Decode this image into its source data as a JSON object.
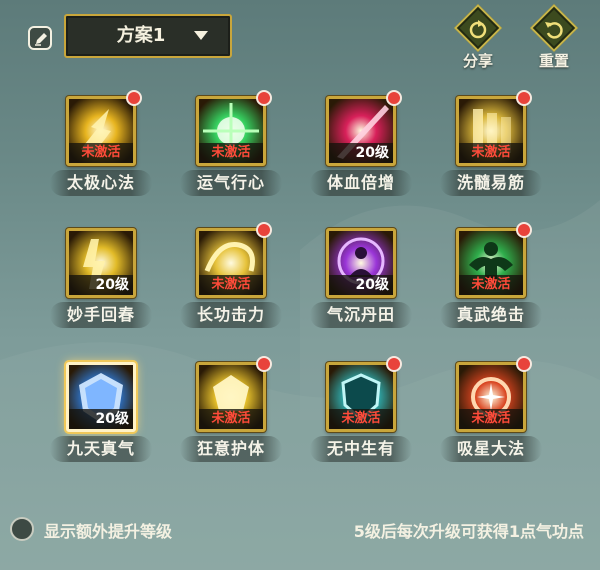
{
  "header": {
    "edit_icon": "edit-icon",
    "plan_name": "方案1",
    "share_label": "分享",
    "reset_label": "重置"
  },
  "skills": [
    {
      "name": "太极心法",
      "status": "未激活",
      "state": "inactive",
      "badge": true,
      "icon": "golden-lightning-orb",
      "color": "#e8b520"
    },
    {
      "name": "运气行心",
      "status": "未激活",
      "state": "inactive",
      "badge": true,
      "icon": "green-energy-burst",
      "color": "#36d060"
    },
    {
      "name": "体血倍增",
      "status": "20级",
      "state": "level",
      "badge": true,
      "icon": "crimson-blade",
      "color": "#d8205a"
    },
    {
      "name": "洗髓易筋",
      "status": "未激活",
      "state": "inactive",
      "badge": true,
      "icon": "golden-scroll-wall",
      "color": "#d9b63a"
    },
    {
      "name": "妙手回春",
      "status": "20级",
      "state": "level",
      "badge": false,
      "icon": "golden-talisman",
      "color": "#e2bb28"
    },
    {
      "name": "长功击力",
      "status": "未激活",
      "state": "inactive",
      "badge": true,
      "icon": "golden-swirl",
      "color": "#e6c23a"
    },
    {
      "name": "气沉丹田",
      "status": "20级",
      "state": "level",
      "badge": false,
      "icon": "purple-meditation",
      "color": "#9a35d8"
    },
    {
      "name": "真武绝击",
      "status": "未激活",
      "state": "inactive",
      "badge": true,
      "icon": "green-strongman",
      "color": "#2fae4c"
    },
    {
      "name": "九天真气",
      "status": "20级",
      "state": "level",
      "badge": false,
      "icon": "blue-crystal-shield",
      "color": "#2f7fe0"
    },
    {
      "name": "狂意护体",
      "status": "未激活",
      "state": "inactive",
      "badge": true,
      "icon": "golden-gem-glow",
      "color": "#e7c12c"
    },
    {
      "name": "无中生有",
      "status": "未激活",
      "state": "inactive",
      "badge": true,
      "icon": "teal-shield-vortex",
      "color": "#2fb5b8"
    },
    {
      "name": "吸星大法",
      "status": "未激活",
      "state": "inactive",
      "badge": true,
      "icon": "red-star-vortex",
      "color": "#d94420"
    }
  ],
  "footer": {
    "toggle_label": "显示额外提升等级",
    "note": "5级后每次升级可获得1点气功点"
  }
}
